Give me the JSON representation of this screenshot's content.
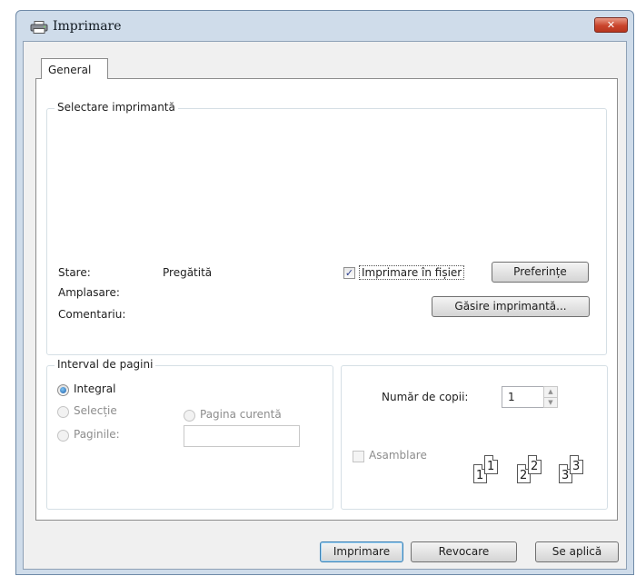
{
  "window": {
    "title": "Imprimare",
    "close_label": "✕"
  },
  "tabs": [
    {
      "label": "General"
    }
  ],
  "printer_group": {
    "legend": "Selectare imprimantă",
    "status_label": "Stare:",
    "status_value": "Pregătită",
    "location_label": "Amplasare:",
    "comment_label": "Comentariu:",
    "print_to_file_label": "Imprimare în fișier",
    "print_to_file_checked": true,
    "preferences_label": "Preferințe",
    "find_printer_label": "Găsire imprimantă..."
  },
  "page_range": {
    "legend": "Interval de pagini",
    "all_label": "Integral",
    "selection_label": "Selecție",
    "current_page_label": "Pagina curentă",
    "pages_label": "Paginile:",
    "pages_value": "",
    "selected": "Integral"
  },
  "copies": {
    "label": "Număr de copii:",
    "value": "1",
    "collate_label": "Asamblare",
    "collate_checked": false,
    "collate_pages": [
      "1",
      "1",
      "2",
      "2",
      "3",
      "3"
    ]
  },
  "footer": {
    "print_label": "Imprimare",
    "cancel_label": "Revocare",
    "apply_label": "Se aplică"
  }
}
